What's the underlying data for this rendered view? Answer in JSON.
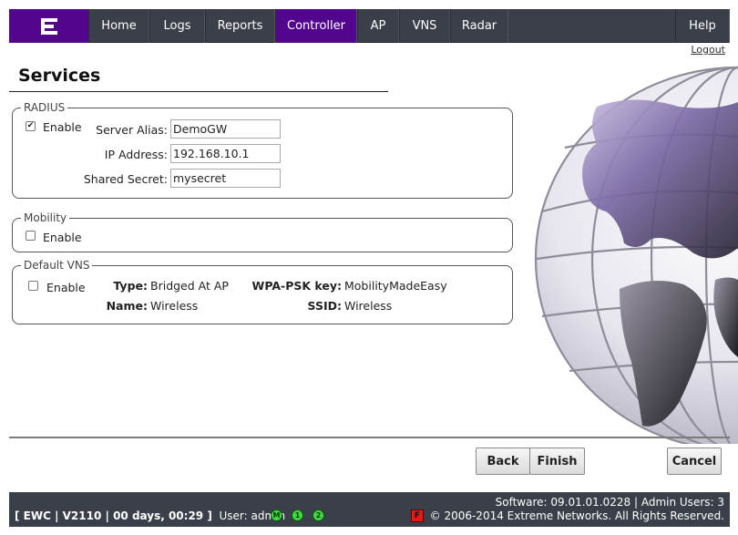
{
  "nav": {
    "tabs": [
      {
        "label": "Home"
      },
      {
        "label": "Logs"
      },
      {
        "label": "Reports"
      },
      {
        "label": "Controller",
        "active": true
      },
      {
        "label": "AP"
      },
      {
        "label": "VNS"
      },
      {
        "label": "Radar"
      }
    ],
    "help": "Help",
    "accent_color": "#51068d"
  },
  "logout": "Logout",
  "page_title": "Services",
  "radius": {
    "legend": "RADIUS",
    "enable_label": "Enable",
    "enabled": true,
    "server_alias_label": "Server Alias:",
    "server_alias_value": "DemoGW",
    "ip_label": "IP Address:",
    "ip_value": "192.168.10.1",
    "secret_label": "Shared Secret:",
    "secret_value": "mysecret"
  },
  "mobility": {
    "legend": "Mobility",
    "enable_label": "Enable",
    "enabled": false
  },
  "default_vns": {
    "legend": "Default VNS",
    "enable_label": "Enable",
    "enabled": false,
    "type_label": "Type:",
    "type_value": "Bridged At AP",
    "wpa_label": "WPA-PSK key:",
    "wpa_value": "MobilityMadeEasy",
    "name_label": "Name:",
    "name_value": "Wireless",
    "ssid_label": "SSID:",
    "ssid_value": "Wireless"
  },
  "buttons": {
    "back": "Back",
    "finish": "Finish",
    "cancel": "Cancel"
  },
  "footer": {
    "status": "[ EWC | V2110 | 00 days, 00:29 ]",
    "user": "User: admin",
    "indicators": [
      "M",
      "1",
      "2"
    ],
    "flag": "F",
    "software": "Software: 09.01.01.0228 | Admin Users: 3",
    "copyright": "© 2006-2014  Extreme Networks. All Rights Reserved."
  }
}
